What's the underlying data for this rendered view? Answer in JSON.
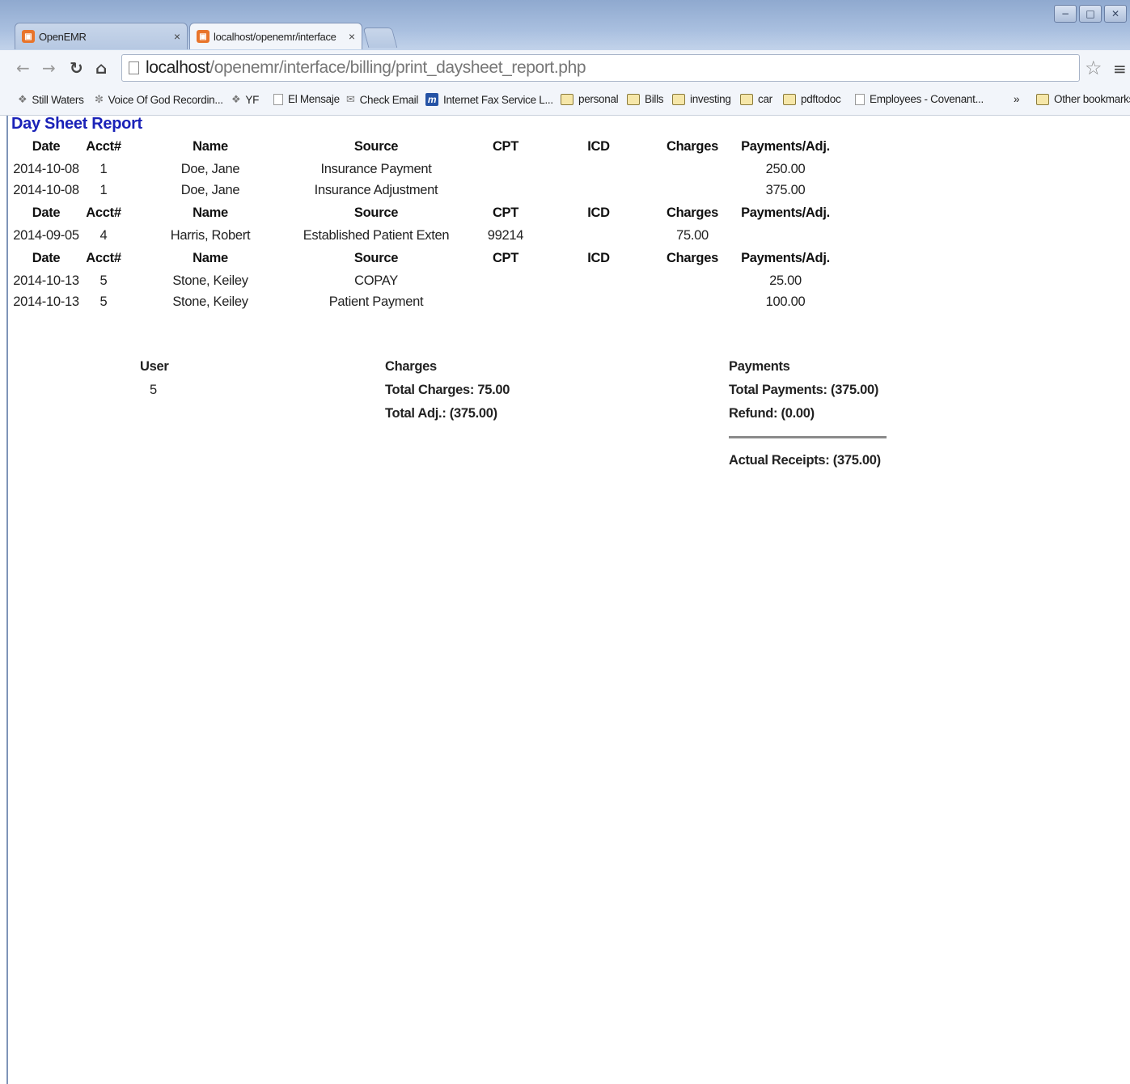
{
  "window": {
    "minimize_icon": "−",
    "maximize_icon": "□",
    "close_icon": "✕"
  },
  "tabs": [
    {
      "title": "OpenEMR",
      "close": "×"
    },
    {
      "title": "localhost/openemr/interface",
      "close": "×"
    }
  ],
  "address": {
    "host": "localhost",
    "path": "/openemr/interface/billing/print_daysheet_report.php"
  },
  "bookmarks": [
    {
      "label": "Still Waters",
      "icon": "feather"
    },
    {
      "label": "Voice Of God Recordin...",
      "icon": "broadcast"
    },
    {
      "label": "YF",
      "icon": "feather"
    },
    {
      "label": "El Mensaje",
      "icon": "doc"
    },
    {
      "label": "Check Email",
      "icon": "mail"
    },
    {
      "label": "Internet Fax Service L...",
      "icon": "m-logo"
    },
    {
      "label": "personal",
      "icon": "folder"
    },
    {
      "label": "Bills",
      "icon": "folder"
    },
    {
      "label": "investing",
      "icon": "folder"
    },
    {
      "label": "car",
      "icon": "folder"
    },
    {
      "label": "pdftodoc",
      "icon": "folder"
    },
    {
      "label": "Employees - Covenant...",
      "icon": "doc"
    }
  ],
  "bookmarks_overflow": "»",
  "other_bookmarks": "Other bookmarks",
  "report": {
    "title": "Day Sheet Report",
    "headers": [
      "Date",
      "Acct#",
      "Name",
      "Source",
      "CPT",
      "ICD",
      "Charges",
      "Payments/Adj."
    ],
    "groups": [
      {
        "rows": [
          {
            "date": "2014-10-08",
            "acct": "1",
            "name": "Doe, Jane",
            "source": "Insurance Payment",
            "cpt": "",
            "icd": "",
            "charges": "",
            "payments": "250.00"
          },
          {
            "date": "2014-10-08",
            "acct": "1",
            "name": "Doe, Jane",
            "source": "Insurance Adjustment",
            "cpt": "",
            "icd": "",
            "charges": "",
            "payments": "375.00"
          }
        ]
      },
      {
        "rows": [
          {
            "date": "2014-09-05",
            "acct": "4",
            "name": "Harris, Robert",
            "source": "Established Patient Exten",
            "cpt": "99214",
            "icd": "",
            "charges": "75.00",
            "payments": ""
          }
        ]
      },
      {
        "rows": [
          {
            "date": "2014-10-13",
            "acct": "5",
            "name": "Stone, Keiley",
            "source": "COPAY",
            "cpt": "",
            "icd": "",
            "charges": "",
            "payments": "25.00"
          },
          {
            "date": "2014-10-13",
            "acct": "5",
            "name": "Stone, Keiley",
            "source": "Patient Payment",
            "cpt": "",
            "icd": "",
            "charges": "",
            "payments": "100.00"
          }
        ]
      }
    ],
    "summary": {
      "user_header": "User",
      "user_value": "5",
      "charges_header": "Charges",
      "total_charges": "Total Charges: 75.00",
      "total_adj": "Total Adj.: (375.00)",
      "payments_header": "Payments",
      "total_payments": "Total Payments: (375.00)",
      "refund": "Refund: (0.00)",
      "actual_receipts": "Actual Receipts: (375.00)"
    }
  }
}
